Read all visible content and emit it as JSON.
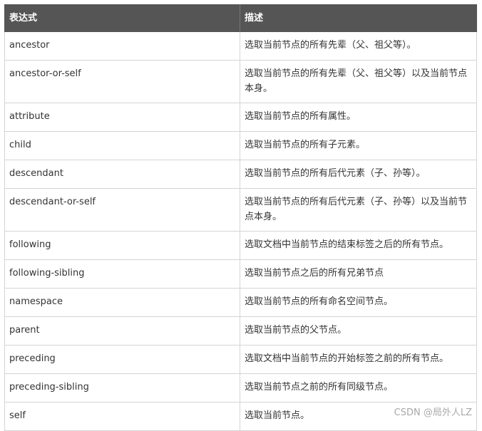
{
  "table": {
    "headers": {
      "expression": "表达式",
      "description": "描述"
    },
    "rows": [
      {
        "axis": "ancestor",
        "desc": "选取当前节点的所有先辈（父、祖父等）。"
      },
      {
        "axis": "ancestor-or-self",
        "desc": "选取当前节点的所有先辈（父、祖父等）以及当前节点本身。"
      },
      {
        "axis": "attribute",
        "desc": "选取当前节点的所有属性。"
      },
      {
        "axis": "child",
        "desc": "选取当前节点的所有子元素。"
      },
      {
        "axis": "descendant",
        "desc": "选取当前节点的所有后代元素（子、孙等）。"
      },
      {
        "axis": "descendant-or-self",
        "desc": "选取当前节点的所有后代元素（子、孙等）以及当前节点本身。"
      },
      {
        "axis": "following",
        "desc": "选取文档中当前节点的结束标签之后的所有节点。"
      },
      {
        "axis": "following-sibling",
        "desc": "选取当前节点之后的所有兄弟节点"
      },
      {
        "axis": "namespace",
        "desc": "选取当前节点的所有命名空间节点。"
      },
      {
        "axis": "parent",
        "desc": "选取当前节点的父节点。"
      },
      {
        "axis": "preceding",
        "desc": "选取文档中当前节点的开始标签之前的所有节点。"
      },
      {
        "axis": "preceding-sibling",
        "desc": "选取当前节点之前的所有同级节点。"
      },
      {
        "axis": "self",
        "desc": "选取当前节点。"
      }
    ]
  },
  "watermark": "CSDN @局外人LZ"
}
